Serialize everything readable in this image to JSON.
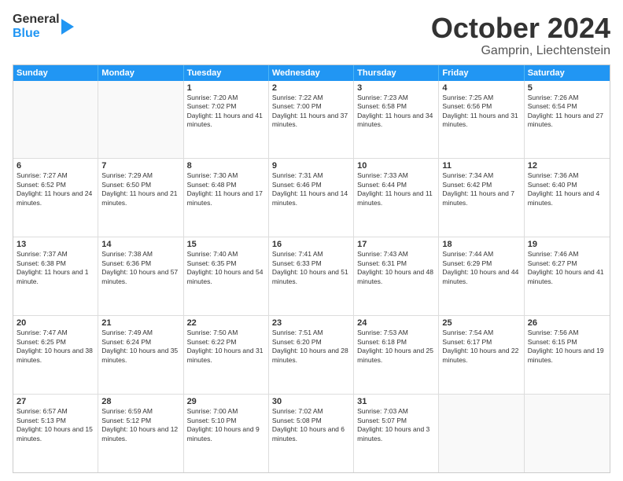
{
  "logo": {
    "general": "General",
    "blue": "Blue"
  },
  "title": "October 2024",
  "location": "Gamprin, Liechtenstein",
  "days": [
    "Sunday",
    "Monday",
    "Tuesday",
    "Wednesday",
    "Thursday",
    "Friday",
    "Saturday"
  ],
  "rows": [
    [
      {
        "day": "",
        "text": ""
      },
      {
        "day": "",
        "text": ""
      },
      {
        "day": "1",
        "text": "Sunrise: 7:20 AM\nSunset: 7:02 PM\nDaylight: 11 hours and 41 minutes."
      },
      {
        "day": "2",
        "text": "Sunrise: 7:22 AM\nSunset: 7:00 PM\nDaylight: 11 hours and 37 minutes."
      },
      {
        "day": "3",
        "text": "Sunrise: 7:23 AM\nSunset: 6:58 PM\nDaylight: 11 hours and 34 minutes."
      },
      {
        "day": "4",
        "text": "Sunrise: 7:25 AM\nSunset: 6:56 PM\nDaylight: 11 hours and 31 minutes."
      },
      {
        "day": "5",
        "text": "Sunrise: 7:26 AM\nSunset: 6:54 PM\nDaylight: 11 hours and 27 minutes."
      }
    ],
    [
      {
        "day": "6",
        "text": "Sunrise: 7:27 AM\nSunset: 6:52 PM\nDaylight: 11 hours and 24 minutes."
      },
      {
        "day": "7",
        "text": "Sunrise: 7:29 AM\nSunset: 6:50 PM\nDaylight: 11 hours and 21 minutes."
      },
      {
        "day": "8",
        "text": "Sunrise: 7:30 AM\nSunset: 6:48 PM\nDaylight: 11 hours and 17 minutes."
      },
      {
        "day": "9",
        "text": "Sunrise: 7:31 AM\nSunset: 6:46 PM\nDaylight: 11 hours and 14 minutes."
      },
      {
        "day": "10",
        "text": "Sunrise: 7:33 AM\nSunset: 6:44 PM\nDaylight: 11 hours and 11 minutes."
      },
      {
        "day": "11",
        "text": "Sunrise: 7:34 AM\nSunset: 6:42 PM\nDaylight: 11 hours and 7 minutes."
      },
      {
        "day": "12",
        "text": "Sunrise: 7:36 AM\nSunset: 6:40 PM\nDaylight: 11 hours and 4 minutes."
      }
    ],
    [
      {
        "day": "13",
        "text": "Sunrise: 7:37 AM\nSunset: 6:38 PM\nDaylight: 11 hours and 1 minute."
      },
      {
        "day": "14",
        "text": "Sunrise: 7:38 AM\nSunset: 6:36 PM\nDaylight: 10 hours and 57 minutes."
      },
      {
        "day": "15",
        "text": "Sunrise: 7:40 AM\nSunset: 6:35 PM\nDaylight: 10 hours and 54 minutes."
      },
      {
        "day": "16",
        "text": "Sunrise: 7:41 AM\nSunset: 6:33 PM\nDaylight: 10 hours and 51 minutes."
      },
      {
        "day": "17",
        "text": "Sunrise: 7:43 AM\nSunset: 6:31 PM\nDaylight: 10 hours and 48 minutes."
      },
      {
        "day": "18",
        "text": "Sunrise: 7:44 AM\nSunset: 6:29 PM\nDaylight: 10 hours and 44 minutes."
      },
      {
        "day": "19",
        "text": "Sunrise: 7:46 AM\nSunset: 6:27 PM\nDaylight: 10 hours and 41 minutes."
      }
    ],
    [
      {
        "day": "20",
        "text": "Sunrise: 7:47 AM\nSunset: 6:25 PM\nDaylight: 10 hours and 38 minutes."
      },
      {
        "day": "21",
        "text": "Sunrise: 7:49 AM\nSunset: 6:24 PM\nDaylight: 10 hours and 35 minutes."
      },
      {
        "day": "22",
        "text": "Sunrise: 7:50 AM\nSunset: 6:22 PM\nDaylight: 10 hours and 31 minutes."
      },
      {
        "day": "23",
        "text": "Sunrise: 7:51 AM\nSunset: 6:20 PM\nDaylight: 10 hours and 28 minutes."
      },
      {
        "day": "24",
        "text": "Sunrise: 7:53 AM\nSunset: 6:18 PM\nDaylight: 10 hours and 25 minutes."
      },
      {
        "day": "25",
        "text": "Sunrise: 7:54 AM\nSunset: 6:17 PM\nDaylight: 10 hours and 22 minutes."
      },
      {
        "day": "26",
        "text": "Sunrise: 7:56 AM\nSunset: 6:15 PM\nDaylight: 10 hours and 19 minutes."
      }
    ],
    [
      {
        "day": "27",
        "text": "Sunrise: 6:57 AM\nSunset: 5:13 PM\nDaylight: 10 hours and 15 minutes."
      },
      {
        "day": "28",
        "text": "Sunrise: 6:59 AM\nSunset: 5:12 PM\nDaylight: 10 hours and 12 minutes."
      },
      {
        "day": "29",
        "text": "Sunrise: 7:00 AM\nSunset: 5:10 PM\nDaylight: 10 hours and 9 minutes."
      },
      {
        "day": "30",
        "text": "Sunrise: 7:02 AM\nSunset: 5:08 PM\nDaylight: 10 hours and 6 minutes."
      },
      {
        "day": "31",
        "text": "Sunrise: 7:03 AM\nSunset: 5:07 PM\nDaylight: 10 hours and 3 minutes."
      },
      {
        "day": "",
        "text": ""
      },
      {
        "day": "",
        "text": ""
      }
    ]
  ]
}
